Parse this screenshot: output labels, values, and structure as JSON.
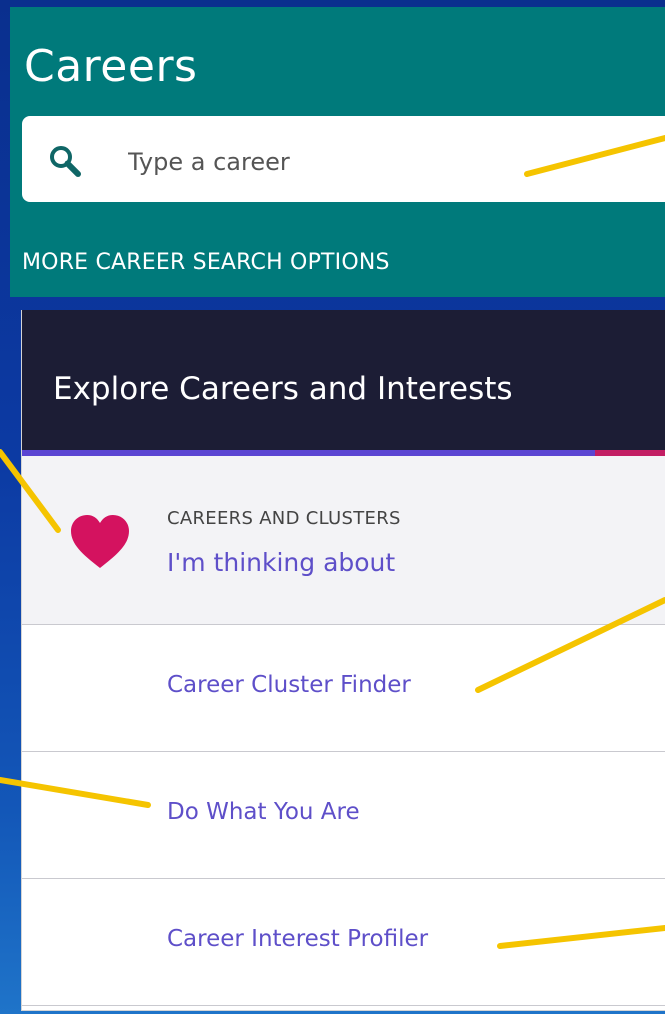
{
  "header": {
    "title": "Careers",
    "more_options_label": "MORE CAREER SEARCH OPTIONS"
  },
  "search": {
    "placeholder": "Type a career",
    "value": "",
    "icon": "search-icon"
  },
  "explore_card": {
    "title": "Explore Careers and Interests",
    "rows": [
      {
        "overline": "CAREERS AND CLUSTERS",
        "label": "I'm thinking about",
        "icon": "heart-icon"
      },
      {
        "label": "Career Cluster Finder"
      },
      {
        "label": "Do What You Are"
      },
      {
        "label": "Career Interest Profiler"
      }
    ]
  },
  "colors": {
    "background_blue": "#0c3aa3",
    "header_teal": "#007a7b",
    "card_header_navy": "#1c1d35",
    "accent_purple": "#5b45d2",
    "accent_pink": "#c21e63",
    "link_purple": "#5e4fc9",
    "heart": "#d4125f",
    "callout_yellow": "#f5c400"
  }
}
